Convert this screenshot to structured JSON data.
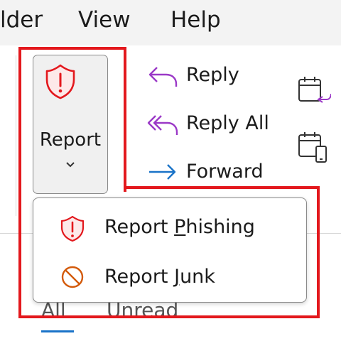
{
  "menubar": {
    "folder": "lder",
    "view": "View",
    "help": "Help"
  },
  "report": {
    "label": "Report"
  },
  "respond": {
    "reply": "Reply",
    "reply_all": "Reply All",
    "forward": "Forward"
  },
  "dropdown": {
    "phishing": {
      "prefix": "Report ",
      "accel": "P",
      "rest": "hishing"
    },
    "junk": {
      "prefix": "Report ",
      "accel": "J",
      "rest": "unk"
    }
  },
  "tabs": {
    "all": "All",
    "unread": "Unread"
  },
  "colors": {
    "highlight": "#e3181d",
    "shield": "#e3181d",
    "junk": "#d35a0a",
    "reply": "#9b39c7",
    "forward": "#1a73c8"
  }
}
